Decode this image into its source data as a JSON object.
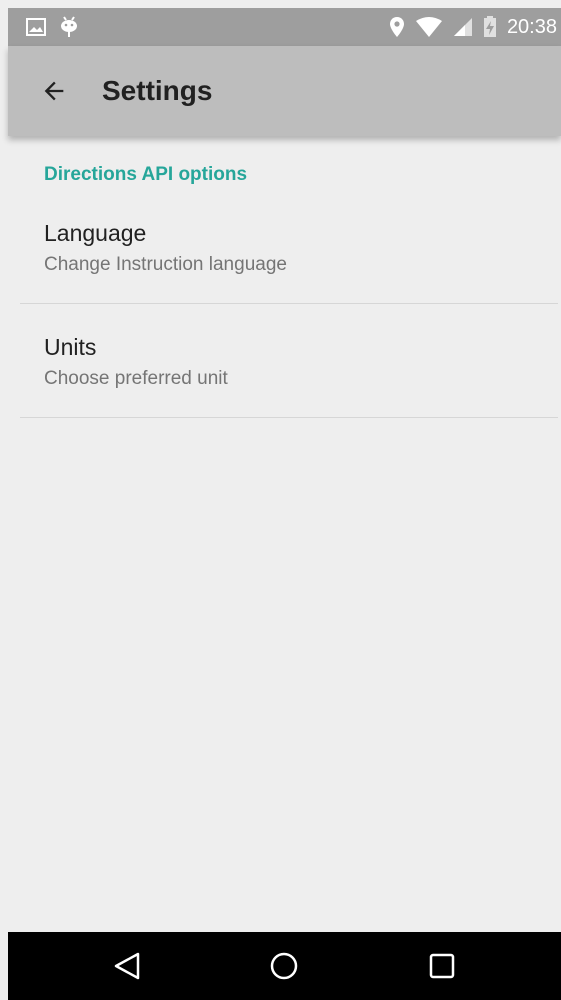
{
  "status_bar": {
    "time": "20:38",
    "icons_left": [
      "image-icon",
      "android-icon"
    ],
    "icons_right": [
      "location-pin-icon",
      "wifi-icon",
      "cell-signal-icon",
      "battery-charging-icon"
    ]
  },
  "app_bar": {
    "title": "Settings",
    "back_icon": "arrow-back-icon"
  },
  "preferences": {
    "category": "Directions API options",
    "items": [
      {
        "title": "Language",
        "summary": "Change Instruction language"
      },
      {
        "title": "Units",
        "summary": "Choose preferred unit"
      }
    ]
  },
  "nav_bar": {
    "icons": [
      "back-triangle-icon",
      "home-circle-icon",
      "recents-square-icon"
    ]
  },
  "colors": {
    "accent": "#26a69a",
    "status_bar": "#9e9e9e",
    "app_bar": "#bdbdbd",
    "background": "#eeeeee",
    "nav_bar": "#000000"
  }
}
